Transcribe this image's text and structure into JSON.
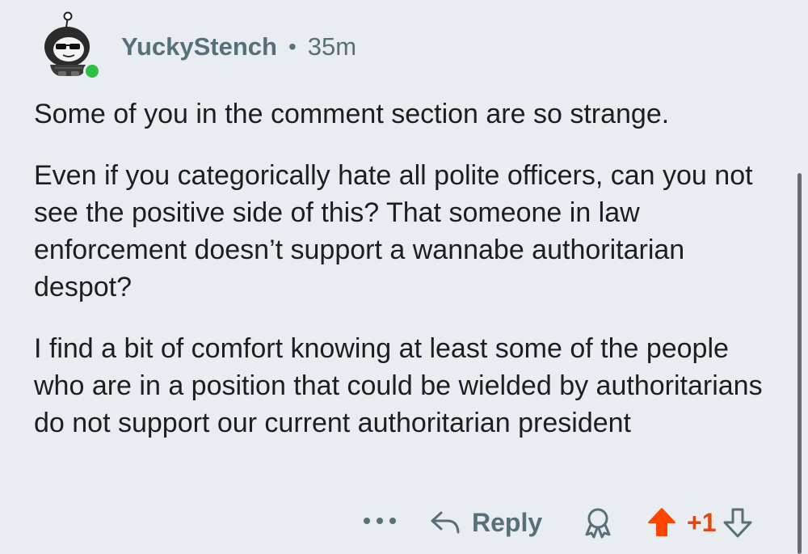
{
  "comment": {
    "username": "YuckyStench",
    "separator": "•",
    "timestamp": "35m",
    "avatar_icon": "snoo-avatar-sunglasses-icon",
    "online_indicator_color": "#2ec043",
    "paragraphs": [
      "Some of you in the comment section are so strange.",
      "Even if you categorically hate all polite officers, can you not see the positive side of this? That someone in law enforcement doesn’t support a wannabe authoritarian despot?",
      "I find a bit of comfort knowing at least some of the people who are in a position that could be wielded by authoritarians do not support our current authoritarian president"
    ]
  },
  "actions": {
    "more_icon": "more-options-icon",
    "reply_icon": "reply-arrow-icon",
    "reply_label": "Reply",
    "award_icon": "award-icon",
    "upvote_icon": "upvote-arrow-icon",
    "upvote_state": "active",
    "upvote_color": "#ff4500",
    "score": "+1",
    "downvote_icon": "downvote-arrow-icon"
  },
  "colors": {
    "background": "#e9ecf0",
    "text": "#1c1e21",
    "meta_text": "#576f76",
    "score_text": "#e24a15"
  }
}
